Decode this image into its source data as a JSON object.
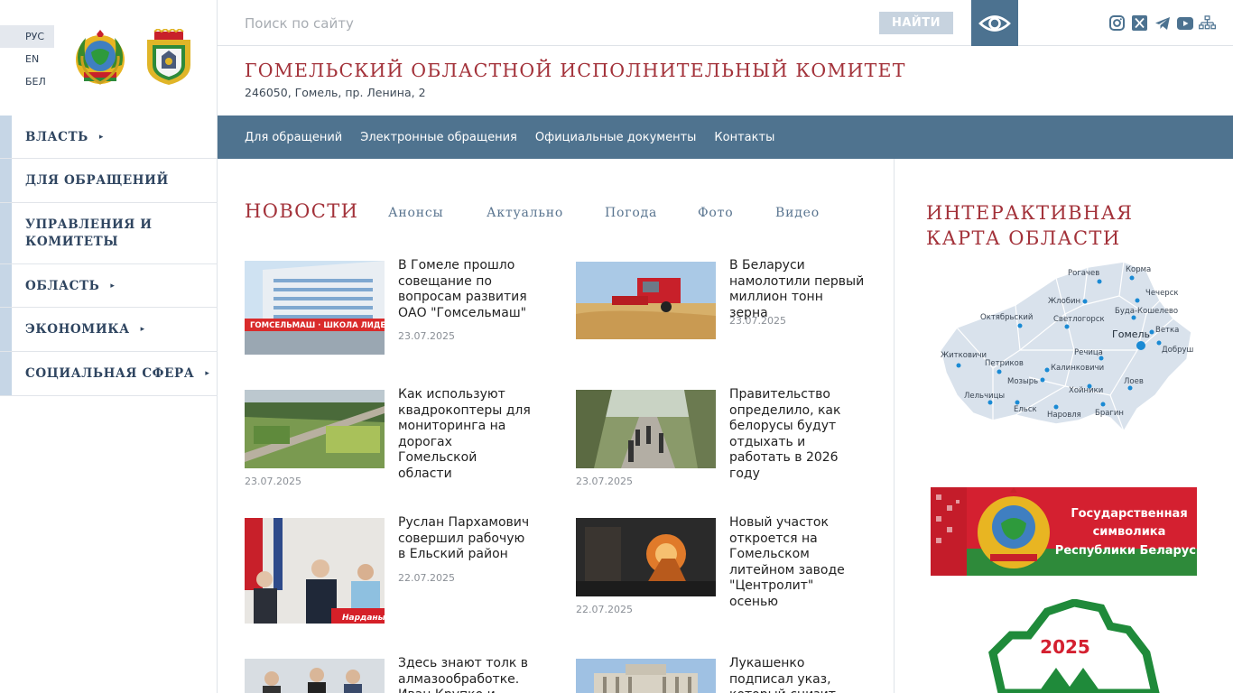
{
  "languages": [
    "РУС",
    "EN",
    "БЕЛ"
  ],
  "sidebar": {
    "items": [
      {
        "label": "ВЛАСТЬ",
        "arrow": "▸"
      },
      {
        "label": "ДЛЯ ОБРАЩЕНИЙ",
        "arrow": ""
      },
      {
        "label": "УПРАВЛЕНИЯ И КОМИТЕТЫ",
        "arrow": ""
      },
      {
        "label": "ОБЛАСТЬ",
        "arrow": "▸"
      },
      {
        "label": "ЭКОНОМИКА",
        "arrow": "▸"
      },
      {
        "label": "СОЦИАЛЬНАЯ СФЕРА",
        "arrow": "▸"
      }
    ]
  },
  "search": {
    "placeholder": "Поиск по сайту",
    "button": "НАЙТИ"
  },
  "icons": {
    "eye": "eye-icon",
    "socials": [
      "instagram-icon",
      "x-icon",
      "telegram-icon",
      "youtube-icon",
      "sitemap-icon"
    ]
  },
  "header": {
    "title": "ГОМЕЛЬСКИЙ ОБЛАСТНОЙ ИСПОЛНИТЕЛЬНЫЙ КОМИТЕТ",
    "address": "246050, Гомель, пр. Ленина, 2"
  },
  "nav": [
    "Для обращений",
    "Электронные обращения",
    "Официальные документы",
    "Контакты"
  ],
  "news": {
    "heading": "НОВОСТИ",
    "tabs": [
      "Анонсы",
      "Актуально",
      "Погода",
      "Фото",
      "Видео"
    ],
    "items": [
      {
        "title": "В Гомеле прошло совещание по вопросам развития ОАО \"Гомсельмаш\"",
        "date": "23.07.2025",
        "image_text": "ГОМСЕЛЬМАШ · ШКОЛА ЛИДЕРОВ АГРОБИЗНЕСА"
      },
      {
        "title": "В Беларуси намолотили первый миллион тонн зерна",
        "date": "23.07.2025"
      },
      {
        "title": "Как используют квадрокоптеры для мониторинга на дорогах Гомельской области",
        "date": "23.07.2025"
      },
      {
        "title": "Правительство определило, как белорусы будут отдыхать и работать в 2026 году",
        "date": "23.07.2025"
      },
      {
        "title": "Руслан Пархамович совершил рабочую в Ельский район",
        "date": "22.07.2025",
        "image_text": "Нарданы"
      },
      {
        "title": "Новый участок откроется на Гомельском литейном заводе \"Центролит\" осенью",
        "date": "22.07.2025"
      },
      {
        "title": "Здесь знают толк в алмазообработке. Иван Крупко и",
        "date": ""
      },
      {
        "title": "Лукашенко подписал указ, который снизит",
        "date": ""
      }
    ]
  },
  "map": {
    "heading": "ИНТЕРАКТИВНАЯ КАРТА ОБЛАСТИ",
    "cities": [
      "Рогачев",
      "Корма",
      "Чечерск",
      "Жлобин",
      "Буда-Кошелево",
      "Октябрьский",
      "Светлогорск",
      "Гомель",
      "Ветка",
      "Добруш",
      "Речица",
      "Житковичи",
      "Петриков",
      "Калинковичи",
      "Мозырь",
      "Лоев",
      "Хойники",
      "Лельчицы",
      "Ельск",
      "Наровля",
      "Брагин"
    ]
  },
  "banner": {
    "line1": "Государственная",
    "line2": "символика",
    "line3": "Республики Беларусь"
  },
  "logo": {
    "year": "2025"
  },
  "colors": {
    "accent": "#a3323a",
    "nav": "#4f738f",
    "sidebar_bar": "#c6d6e6"
  }
}
